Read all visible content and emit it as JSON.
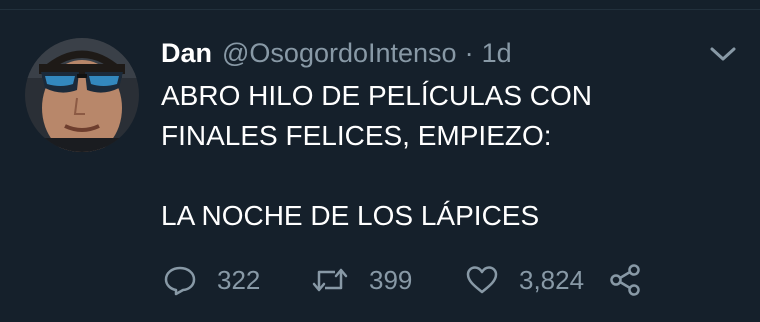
{
  "tweet": {
    "author_name": "Dan",
    "author_handle": "@OsogordoIntenso",
    "separator": "·",
    "time_ago": "1d",
    "body_lines": [
      "ABRO HILO DE PELÍCULAS CON",
      "FINALES FELICES, EMPIEZO:",
      "",
      "LA NOCHE DE LOS LÁPICES"
    ],
    "stats": {
      "replies": "322",
      "retweets": "399",
      "likes": "3,824"
    }
  },
  "icons": {
    "caret": "chevron-down-icon",
    "reply": "reply-icon",
    "retweet": "retweet-icon",
    "like": "heart-icon",
    "share": "share-icon"
  },
  "colors": {
    "background": "#15202b",
    "text": "#ffffff",
    "muted": "#8899a6",
    "divider": "#22303c"
  }
}
